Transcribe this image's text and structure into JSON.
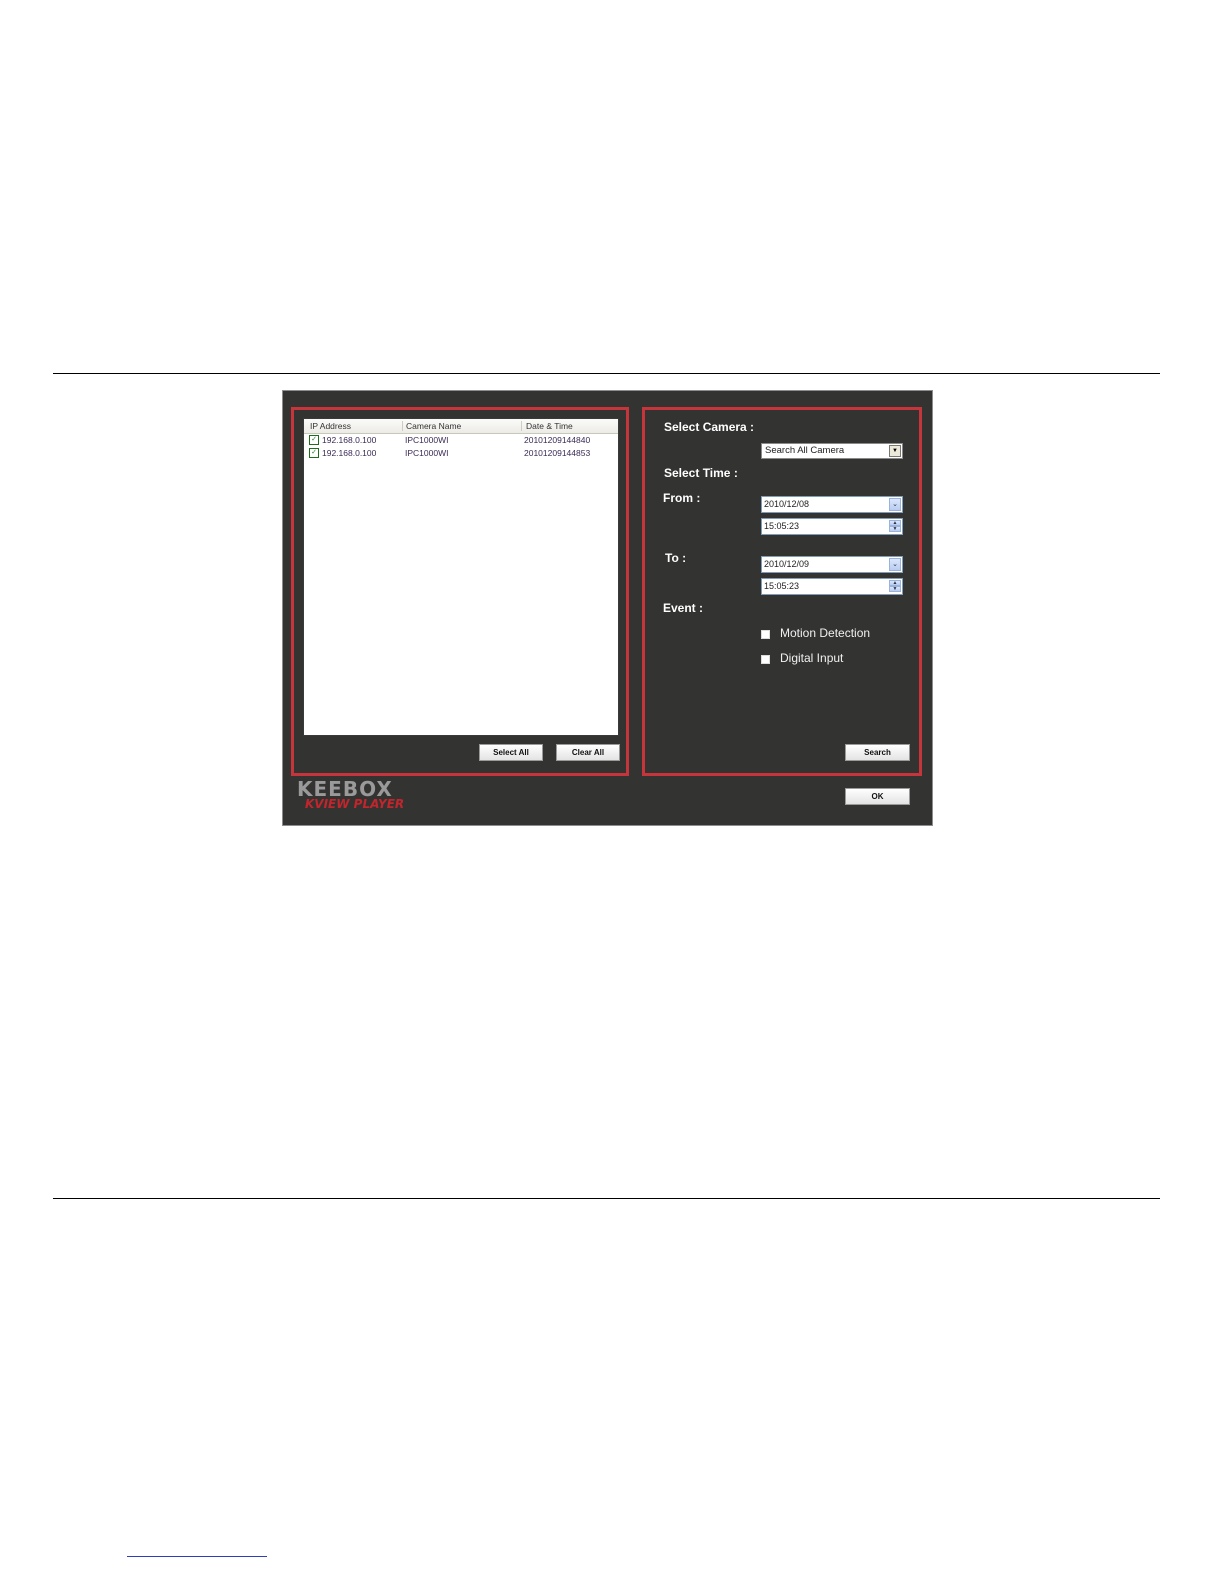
{
  "list": {
    "columns": [
      "IP Address",
      "Camera Name",
      "Date & Time"
    ],
    "rows": [
      {
        "ip": "192.168.0.100",
        "camera": "IPC1000WI",
        "datetime": "20101209144840",
        "checked": true
      },
      {
        "ip": "192.168.0.100",
        "camera": "IPC1000WI",
        "datetime": "20101209144853",
        "checked": true
      }
    ]
  },
  "buttons": {
    "select_all": "Select All",
    "clear_all": "Clear All",
    "search": "Search",
    "ok": "OK"
  },
  "form": {
    "select_camera_label": "Select Camera :",
    "camera_value": "Search All Camera",
    "select_time_label": "Select Time :",
    "from_label": "From :",
    "from_date": "2010/12/08",
    "from_time": "15:05:23",
    "to_label": "To :",
    "to_date": "2010/12/09",
    "to_time": "15:05:23",
    "event_label": "Event :",
    "events": [
      {
        "label": "Motion Detection",
        "checked": false
      },
      {
        "label": "Digital Input",
        "checked": false
      }
    ]
  },
  "logo": {
    "brand": "KEEBOX",
    "product": "KVIEW PLAYER"
  },
  "colors": {
    "panel_border": "#c6343c",
    "window_bg": "#333432",
    "logo_red": "#c2252c"
  }
}
